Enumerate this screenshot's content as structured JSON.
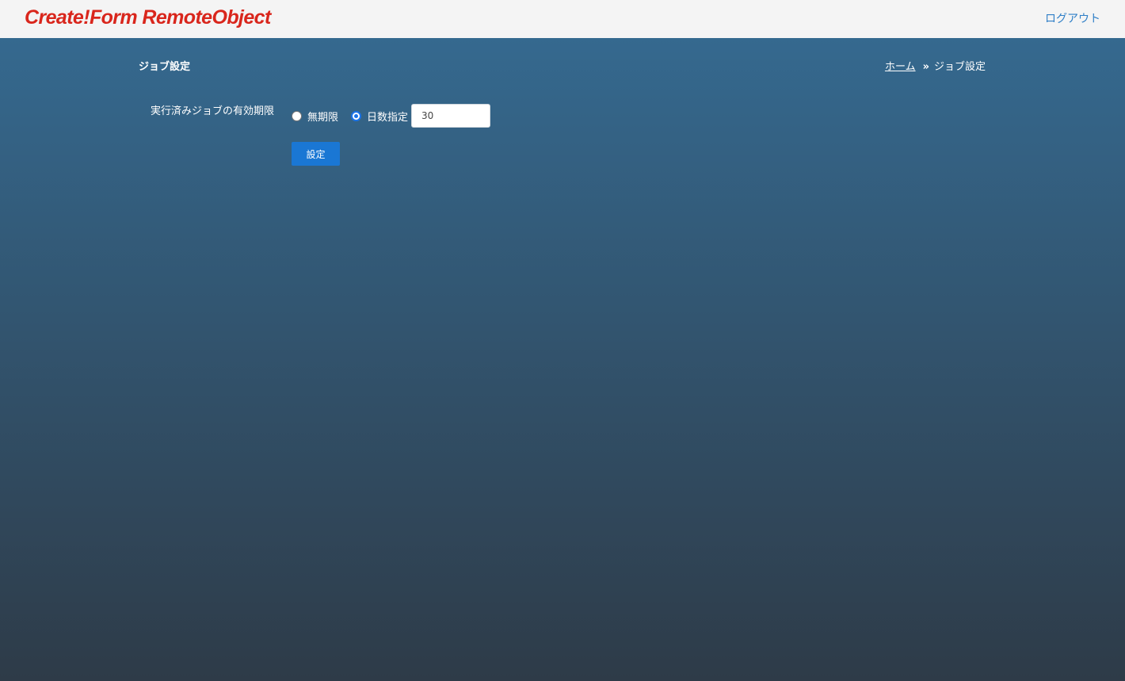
{
  "header": {
    "logo_text": "Create!Form RemoteObject",
    "logout_label": "ログアウト"
  },
  "page": {
    "title": "ジョブ設定"
  },
  "breadcrumb": {
    "home_label": "ホーム",
    "separator": "»",
    "current_label": "ジョブ設定"
  },
  "form": {
    "expiry_label": "実行済みジョブの有効期限",
    "options": [
      {
        "label": "無期限",
        "selected": false
      },
      {
        "label": "日数指定",
        "selected": true
      }
    ],
    "days_value": "30",
    "submit_label": "設定"
  },
  "colors": {
    "logo": "#d9261c",
    "link": "#2f7fc7",
    "button": "#1a77d4",
    "radio_checked": "#1a73e8",
    "background_top": "#35698f",
    "background_bottom": "#2e3b48"
  }
}
